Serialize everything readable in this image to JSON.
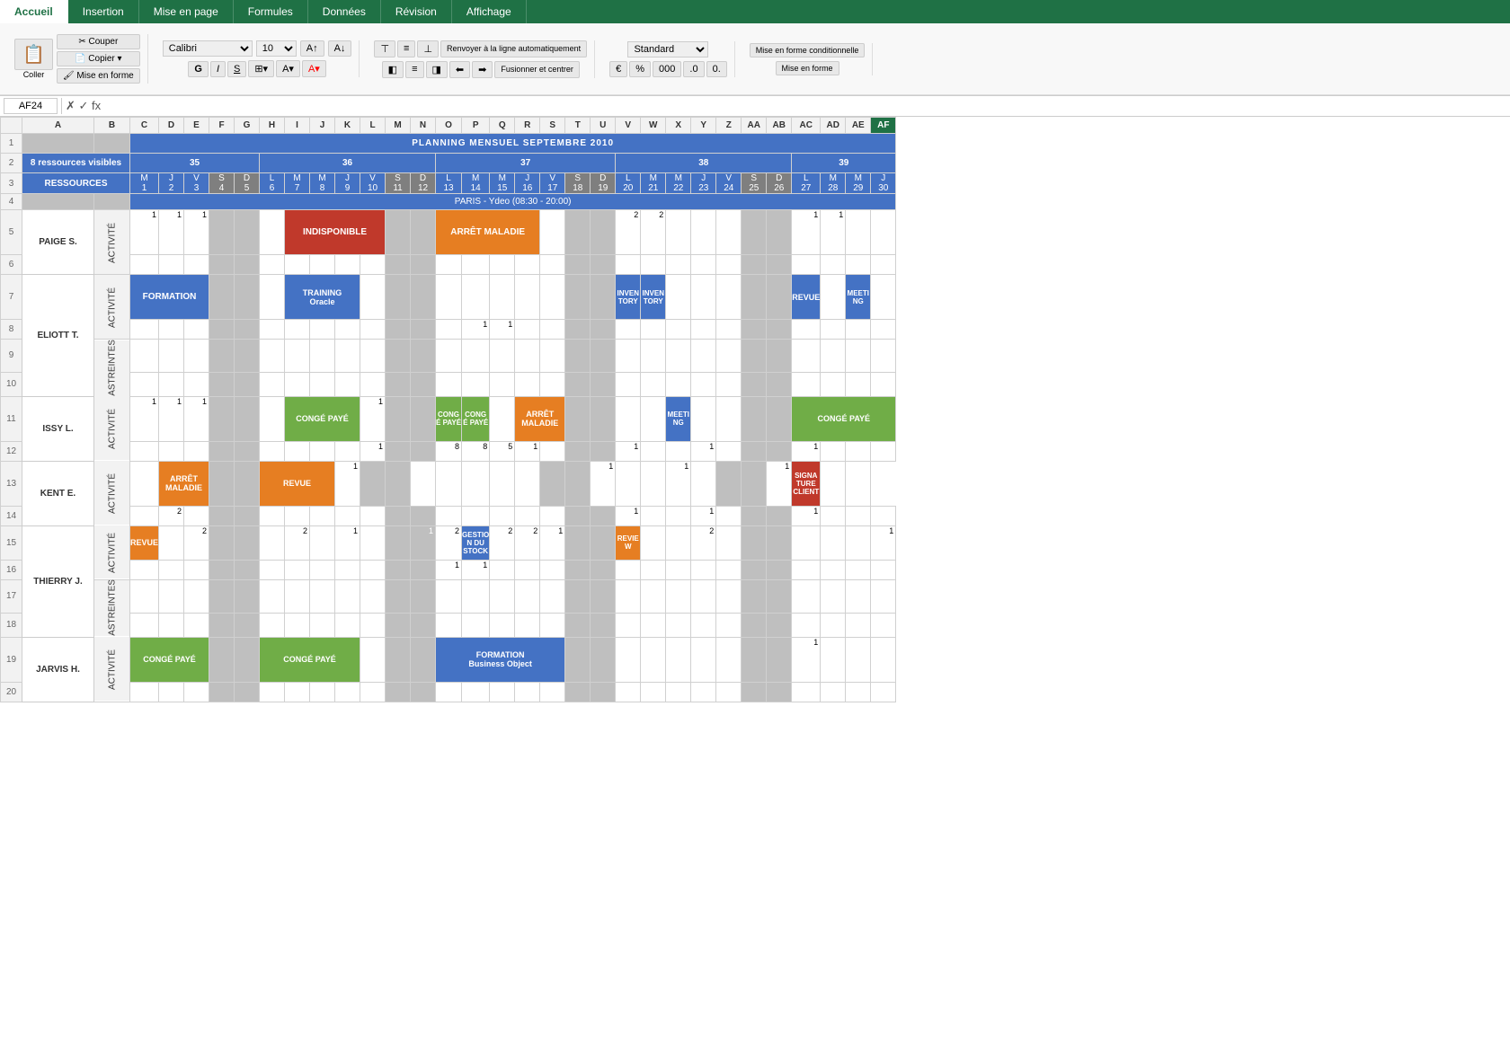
{
  "ribbon": {
    "tabs": [
      "Accueil",
      "Insertion",
      "Mise en page",
      "Formules",
      "Données",
      "Révision",
      "Affichage"
    ],
    "active_tab": "Accueil",
    "font": "Calibri",
    "font_size": "10",
    "wrap_text": "Renvoyer à la ligne automatiquement",
    "merge_center": "Fusionner et centrer",
    "format": "Standard",
    "conditional_format": "Mise en forme conditionnelle",
    "cell_styles": "Mise en forme",
    "buttons": {
      "coller": "Coller",
      "couper": "Couper",
      "copier": "Copier",
      "mise_en_forme": "Mise en forme"
    }
  },
  "formula_bar": {
    "cell_ref": "AF24",
    "formula": ""
  },
  "planning": {
    "title": "PLANNING MENSUEL SEPTEMBRE 2010",
    "resources_count": "8 ressources visibles",
    "paris_label": "PARIS - Ydeo (08:30 - 20:00)",
    "resources_label": "RESSOURCES",
    "weeks": [
      {
        "num": "35",
        "days": [
          {
            "label": "M",
            "num": "1"
          },
          {
            "label": "J",
            "num": "2"
          },
          {
            "label": "V",
            "num": "3"
          },
          {
            "label": "S",
            "num": "4",
            "weekend": true
          },
          {
            "label": "D",
            "num": "5",
            "weekend": true
          }
        ]
      },
      {
        "num": "36",
        "days": [
          {
            "label": "L",
            "num": "6"
          },
          {
            "label": "M",
            "num": "7"
          },
          {
            "label": "M",
            "num": "8"
          },
          {
            "label": "J",
            "num": "9"
          },
          {
            "label": "V",
            "num": "10"
          },
          {
            "label": "S",
            "num": "11",
            "weekend": true
          },
          {
            "label": "D",
            "num": "12",
            "weekend": true
          }
        ]
      },
      {
        "num": "37",
        "days": [
          {
            "label": "L",
            "num": "13"
          },
          {
            "label": "M",
            "num": "14"
          },
          {
            "label": "M",
            "num": "15"
          },
          {
            "label": "J",
            "num": "16"
          },
          {
            "label": "V",
            "num": "17"
          },
          {
            "label": "S",
            "num": "18",
            "weekend": true
          },
          {
            "label": "D",
            "num": "19",
            "weekend": true
          }
        ]
      },
      {
        "num": "38",
        "days": [
          {
            "label": "L",
            "num": "20"
          },
          {
            "label": "M",
            "num": "21"
          },
          {
            "label": "M",
            "num": "22"
          },
          {
            "label": "J",
            "num": "23"
          },
          {
            "label": "V",
            "num": "24"
          },
          {
            "label": "S",
            "num": "25",
            "weekend": true
          },
          {
            "label": "D",
            "num": "26",
            "weekend": true
          }
        ]
      },
      {
        "num": "39",
        "days": [
          {
            "label": "L",
            "num": "27"
          },
          {
            "label": "M",
            "num": "28"
          },
          {
            "label": "M",
            "num": "29"
          },
          {
            "label": "J",
            "num": "30"
          }
        ]
      }
    ],
    "employees": [
      {
        "name": "PAIGE S.",
        "rows": [
          {
            "type": "ACTIVITÉ",
            "events": [
              {
                "day": 1,
                "text": "1",
                "style": "number"
              },
              {
                "day": 2,
                "text": "1",
                "style": "number"
              },
              {
                "day": 3,
                "text": "1",
                "style": "number"
              },
              {
                "day": 8,
                "text": "INDISPONIBLE",
                "style": "red",
                "span": 4
              },
              {
                "day": 13,
                "text": "ARRÊT MALADIE",
                "style": "orange",
                "span": 4
              },
              {
                "day": 20,
                "text": "2",
                "style": "number"
              },
              {
                "day": 21,
                "text": "2",
                "style": "number"
              },
              {
                "day": 27,
                "text": "1",
                "style": "number"
              },
              {
                "day": 28,
                "text": "1",
                "style": "number"
              }
            ]
          },
          {
            "type": null,
            "events": []
          }
        ]
      },
      {
        "name": "ELIOTT T.",
        "rows": [
          {
            "type": "ACTIVITÉ",
            "events": [
              {
                "day": 1,
                "text": "FORMATION",
                "style": "steel-blue",
                "span": 3
              },
              {
                "day": 8,
                "text": "TRAINING Oracle",
                "style": "steel-blue",
                "span": 3
              },
              {
                "day": 20,
                "text": "INVEN TORY",
                "style": "steel-blue",
                "span": 1
              },
              {
                "day": 21,
                "text": "INVEN TORY",
                "style": "steel-blue",
                "span": 1
              },
              {
                "day": 27,
                "text": "REVUE",
                "style": "steel-blue",
                "span": 1
              },
              {
                "day": 29,
                "text": "MEETI NG",
                "style": "steel-blue",
                "span": 1
              }
            ]
          },
          {
            "type": "ASTREINTES",
            "events": [
              {
                "day": 14,
                "text": "1",
                "style": "number"
              },
              {
                "day": 15,
                "text": "1",
                "style": "number"
              }
            ]
          }
        ]
      },
      {
        "name": "ISSY L.",
        "rows": [
          {
            "type": "ACTIVITÉ",
            "events": [
              {
                "day": 1,
                "text": "1",
                "style": "number"
              },
              {
                "day": 2,
                "text": "1",
                "style": "number"
              },
              {
                "day": 3,
                "text": "1",
                "style": "number"
              },
              {
                "day": 7,
                "text": "CONGÉ PAYÉ",
                "style": "green",
                "span": 3
              },
              {
                "day": 9,
                "text": "1",
                "style": "number"
              },
              {
                "day": 10,
                "text": "1",
                "style": "number"
              },
              {
                "day": 13,
                "text": "CONGÉ PAYÉ",
                "style": "green",
                "span": 1
              },
              {
                "day": 14,
                "text": "CONGÉ PAYÉ",
                "style": "green",
                "span": 1
              },
              {
                "day": 16,
                "text": "ARRÊT MALADIE",
                "style": "orange",
                "span": 2
              },
              {
                "day": 22,
                "text": "MEETI NG",
                "style": "steel-blue",
                "span": 1
              },
              {
                "day": 27,
                "text": "CONGÉ PAYÉ",
                "style": "green",
                "span": 4
              }
            ]
          },
          {
            "type": null,
            "events": [
              {
                "day": 13,
                "text": "8",
                "style": "number"
              },
              {
                "day": 14,
                "text": "8",
                "style": "number"
              },
              {
                "day": 15,
                "text": "5",
                "style": "number"
              },
              {
                "day": 16,
                "text": "1",
                "style": "number"
              },
              {
                "day": 20,
                "text": "1",
                "style": "number"
              },
              {
                "day": 23,
                "text": "1",
                "style": "number"
              },
              {
                "day": 27,
                "text": "1",
                "style": "number"
              }
            ]
          }
        ]
      },
      {
        "name": "KENT E.",
        "rows": [
          {
            "type": "ACTIVITÉ",
            "events": [
              {
                "day": 2,
                "text": "ARRÊT MALADIE",
                "style": "orange",
                "span": 2
              },
              {
                "day": 7,
                "text": "REVUE",
                "style": "orange",
                "span": 3
              },
              {
                "day": 10,
                "text": "1",
                "style": "number"
              },
              {
                "day": 28,
                "text": "SIGNA TURE CLIENT",
                "style": "red",
                "span": 1
              }
            ]
          },
          {
            "type": null,
            "events": [
              {
                "day": 3,
                "text": "2",
                "style": "number"
              },
              {
                "day": 20,
                "text": "1",
                "style": "number"
              },
              {
                "day": 23,
                "text": "1",
                "style": "number"
              },
              {
                "day": 27,
                "text": "1",
                "style": "number"
              }
            ]
          }
        ]
      },
      {
        "name": "THIERRY J.",
        "rows": [
          {
            "type": "ACTIVITÉ",
            "events": [
              {
                "day": 1,
                "text": "REVUE",
                "style": "orange",
                "span": 1
              },
              {
                "day": 3,
                "text": "2",
                "style": "number"
              },
              {
                "day": 8,
                "text": "2",
                "style": "number"
              },
              {
                "day": 10,
                "text": "1",
                "style": "number"
              },
              {
                "day": 12,
                "text": "1",
                "style": "number"
              },
              {
                "day": 13,
                "text": "2",
                "style": "number"
              },
              {
                "day": 14,
                "text": "2",
                "style": "number"
              },
              {
                "day": 15,
                "text": "2",
                "style": "number"
              },
              {
                "day": 16,
                "text": "1",
                "style": "number"
              },
              {
                "day": 14,
                "text": "GESTIO N DU STOCK",
                "style": "steel-blue",
                "span": 1
              },
              {
                "day": 20,
                "text": "REVIE W",
                "style": "orange",
                "span": 1
              },
              {
                "day": 23,
                "text": "2",
                "style": "number"
              },
              {
                "day": 30,
                "text": "1",
                "style": "number"
              }
            ]
          },
          {
            "type": "ASTREINTES",
            "events": [
              {
                "day": 13,
                "text": "1",
                "style": "number"
              },
              {
                "day": 14,
                "text": "1",
                "style": "number"
              }
            ]
          }
        ]
      },
      {
        "name": "JARVIS H.",
        "rows": [
          {
            "type": "ACTIVITÉ",
            "events": [
              {
                "day": 1,
                "text": "CONGÉ PAYÉ",
                "style": "green",
                "span": 3
              },
              {
                "day": 7,
                "text": "CONGÉ PAYÉ",
                "style": "green",
                "span": 4
              },
              {
                "day": 13,
                "text": "FORMATION Business Object",
                "style": "steel-blue",
                "span": 5
              },
              {
                "day": 27,
                "text": "1",
                "style": "number"
              }
            ]
          },
          {
            "type": null,
            "events": []
          }
        ]
      }
    ]
  },
  "colors": {
    "accent_green": "#1f7145",
    "ribbon_bg": "#f8f8f8",
    "header_blue": "#4472c4",
    "cell_red": "#c0392b",
    "cell_orange": "#e67e22",
    "cell_green": "#70ad47",
    "cell_gray": "#bfbfbf",
    "weekend_gray": "#7f7f7f",
    "row_gray": "#d9d9d9"
  }
}
